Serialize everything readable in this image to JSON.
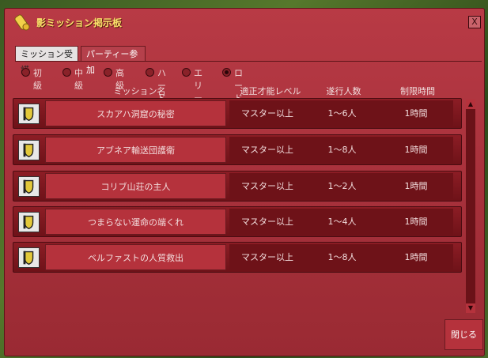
{
  "window": {
    "title": "影ミッション掲示板"
  },
  "tabs": [
    {
      "label": "ミッション受諾"
    },
    {
      "label": "パーティー参加"
    }
  ],
  "filters": [
    {
      "label": "初級",
      "checked": false
    },
    {
      "label": "中級",
      "checked": false
    },
    {
      "label": "高級",
      "checked": false
    },
    {
      "label": "ハード",
      "checked": false
    },
    {
      "label": "エリート",
      "checked": false
    },
    {
      "label": "ロード",
      "checked": true
    }
  ],
  "table": {
    "headers": {
      "name": "ミッション名",
      "level": "適正才能レベル",
      "people": "遂行人数",
      "time": "制限時間"
    },
    "rows": [
      {
        "name": "スカアハ洞窟の秘密",
        "level": "マスター以上",
        "people": "1～6人",
        "time": "1時間"
      },
      {
        "name": "アブネア輸送団護衛",
        "level": "マスター以上",
        "people": "1～8人",
        "time": "1時間"
      },
      {
        "name": "コリブ山荘の主人",
        "level": "マスター以上",
        "people": "1～2人",
        "time": "1時間"
      },
      {
        "name": "つまらない運命の端くれ",
        "level": "マスター以上",
        "people": "1～4人",
        "time": "1時間"
      },
      {
        "name": "ベルファストの人質救出",
        "level": "マスター以上",
        "people": "1～8人",
        "time": "1時間"
      }
    ]
  },
  "buttons": {
    "close": "閉じる",
    "close_x": "X"
  }
}
